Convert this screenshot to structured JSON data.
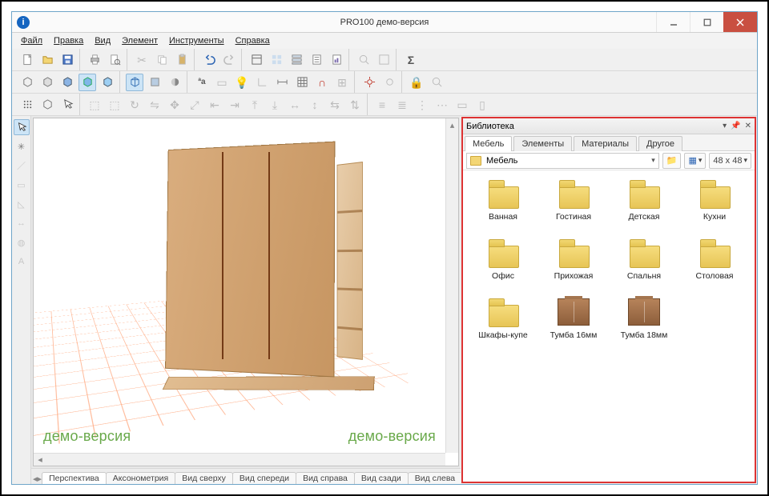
{
  "window": {
    "title": "PRO100 демо-версия",
    "app_icon_letter": "i"
  },
  "menu": [
    "Файл",
    "Правка",
    "Вид",
    "Элемент",
    "Инструменты",
    "Справка"
  ],
  "watermark": "демо-версия",
  "view_tabs": [
    "Перспектива",
    "Аксонометрия",
    "Вид сверху",
    "Вид спереди",
    "Вид справа",
    "Вид сзади",
    "Вид слева"
  ],
  "active_view_tab": 0,
  "library": {
    "title": "Библиотека",
    "tabs": [
      "Мебель",
      "Элементы",
      "Материалы",
      "Другое"
    ],
    "active_tab": 0,
    "path": "Мебель",
    "thumb_size": "48 x  48",
    "items": [
      {
        "label": "Ванная",
        "kind": "folder"
      },
      {
        "label": "Гостиная",
        "kind": "folder"
      },
      {
        "label": "Детская",
        "kind": "folder"
      },
      {
        "label": "Кухни",
        "kind": "folder"
      },
      {
        "label": "Офис",
        "kind": "folder"
      },
      {
        "label": "Прихожая",
        "kind": "folder"
      },
      {
        "label": "Спальня",
        "kind": "folder"
      },
      {
        "label": "Столовая",
        "kind": "folder"
      },
      {
        "label": "Шкафы-купе",
        "kind": "folder"
      },
      {
        "label": "Тумба 16мм",
        "kind": "cabinet"
      },
      {
        "label": "Тумба 18мм",
        "kind": "cabinet"
      }
    ]
  }
}
